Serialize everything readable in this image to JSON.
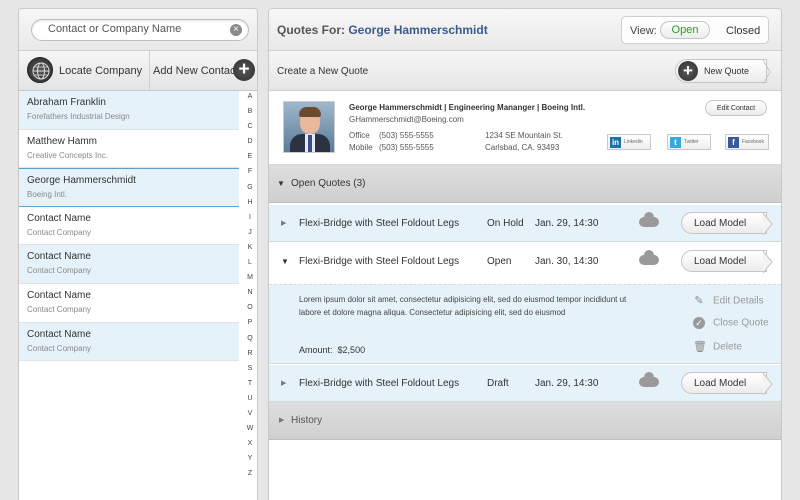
{
  "left": {
    "search_placeholder": "Contact or Company Name",
    "locate_label": "Locate Company",
    "add_label": "Add New Contact",
    "contacts": [
      {
        "name": "Abraham Franklin",
        "company": "Forefathers Industrial Design"
      },
      {
        "name": "Matthew Hamm",
        "company": "Creative Concepts Inc."
      },
      {
        "name": "George Hammerschmidt",
        "company": "Boeing Intl."
      },
      {
        "name": "Contact Name",
        "company": "Contact Company"
      },
      {
        "name": "Contact Name",
        "company": "Contact Company"
      },
      {
        "name": "Contact Name",
        "company": "Contact Company"
      },
      {
        "name": "Contact Name",
        "company": "Contact Company"
      }
    ],
    "alphabet": [
      "A",
      "B",
      "C",
      "D",
      "E",
      "F",
      "G",
      "H",
      "I",
      "J",
      "K",
      "L",
      "M",
      "N",
      "O",
      "P",
      "Q",
      "R",
      "S",
      "T",
      "U",
      "V",
      "W",
      "X",
      "Y",
      "Z"
    ]
  },
  "header": {
    "quotes_for": "Quotes For:",
    "contact_name": "George Hammerschmidt",
    "view_label": "View:",
    "open": "Open",
    "closed": "Closed"
  },
  "actions": {
    "create": "Create a New Quote",
    "new_quote": "New Quote"
  },
  "card": {
    "title": "George Hammerschmidt  |  Engineering Mananger  |  Boeing Intl.",
    "email": "GHammerschmidt@Boeing.com",
    "office_label": "Office",
    "office": "(503) 555-5555",
    "mobile_label": "Mobile",
    "mobile": "(503) 555-5555",
    "address1": "1234 SE Mountain St.",
    "address2": "Carlsbad, CA. 93493",
    "edit_contact": "Edit Contact",
    "linkedin": "Linkedin",
    "twitter": "Twitter",
    "facebook": "Facebook"
  },
  "open_quotes": "Open Quotes (3)",
  "quotes": [
    {
      "name": "Flexi-Bridge with Steel Foldout Legs",
      "status": "On Hold",
      "date": "Jan. 29, 14:30"
    },
    {
      "name": "Flexi-Bridge with Steel Foldout Legs",
      "status": "Open",
      "date": "Jan. 30, 14:30"
    },
    {
      "name": "Flexi-Bridge with Steel Foldout Legs",
      "status": "Draft",
      "date": "Jan. 29, 14:30"
    }
  ],
  "load_model": "Load Model",
  "detail": {
    "description": "Lorem ipsum dolor sit amet, consectetur adipisicing elit, sed do eiusmod tempor incididunt ut labore et dolore magna aliqua. Consectetur adipisicing elit, sed do eiusmod",
    "amount_label": "Amount:",
    "amount": "$2,500",
    "edit": "Edit Details",
    "close": "Close Quote",
    "delete": "Delete"
  },
  "history": "History"
}
